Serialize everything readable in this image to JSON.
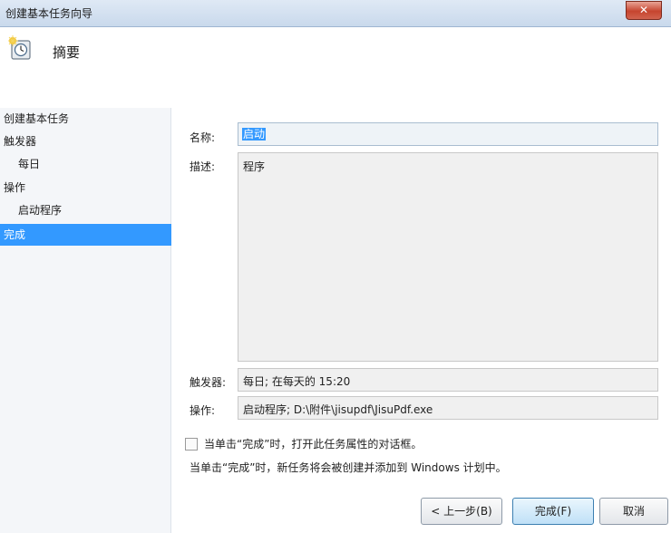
{
  "window": {
    "title": "创建基本任务向导",
    "close_label": "✕"
  },
  "header": {
    "icon": "task-scheduler-clock-icon",
    "heading": "摘要"
  },
  "sidebar": {
    "items": [
      {
        "label": "创建基本任务"
      },
      {
        "label": "触发器"
      },
      {
        "label": "每日"
      },
      {
        "label": "操作"
      },
      {
        "label": "启动程序"
      },
      {
        "label": "完成",
        "selected": true
      }
    ]
  },
  "form": {
    "name_label": "名称:",
    "name_value": "启动",
    "desc_label": "描述:",
    "desc_value": "程序",
    "trigger_label": "触发器:",
    "trigger_value": "每日; 在每天的 15:20",
    "action_label": "操作:",
    "action_value": "启动程序; D:\\附件\\jisupdf\\JisuPdf.exe",
    "open_props_label": "当单击“完成”时，打开此任务属性的对话框。",
    "open_props_checked": false,
    "info_text": "当单击“完成”时，新任务将会被创建并添加到 Windows 计划中。"
  },
  "buttons": {
    "back": "< 上一步(B)",
    "finish": "完成(F)",
    "cancel": "取消"
  },
  "colors": {
    "selection": "#3399ff"
  }
}
